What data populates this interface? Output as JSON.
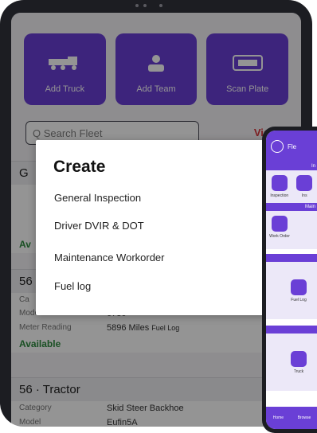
{
  "tablet": {
    "tiles": [
      {
        "label": "Add Truck",
        "icon": "truck-icon"
      },
      {
        "label": "Add Team",
        "icon": "person-icon"
      },
      {
        "label": "Scan Plate",
        "icon": "scan-icon"
      }
    ],
    "search": {
      "text": "Q  Search Fleet",
      "view_all": "View All"
    },
    "cards": [
      {
        "title": "G"
      },
      {
        "title": "56",
        "rows": [
          {
            "key": "Ca",
            "value": ""
          },
          {
            "key": "Model",
            "value": "6780"
          },
          {
            "key": "Meter Reading",
            "value": "5896 Miles"
          }
        ],
        "status": "Available"
      },
      {
        "title": "56 · Tractor",
        "rows": [
          {
            "key": "Category",
            "value": "Skid Steer Backhoe"
          },
          {
            "key": "Model",
            "value": "Eufin5A"
          }
        ]
      }
    ],
    "first_card_status": "Av",
    "fuel_log_behind": "Fuel Log"
  },
  "popup": {
    "title": "Create",
    "options": [
      "General Inspection",
      "Driver DVIR & DOT",
      "Maintenance Workorder",
      "Fuel log"
    ]
  },
  "phone": {
    "header": "Fle",
    "band1": "In",
    "sect1": [
      "Inspection",
      "Ins"
    ],
    "band2": "Main",
    "sect2": [
      "Work Order"
    ],
    "sect3": [
      "Fuel Log"
    ],
    "sect4": [
      "Truck"
    ],
    "nav": [
      "Home",
      "Browse"
    ]
  },
  "colors": {
    "brand": "#6a3fd6",
    "accent": "#d8343a",
    "success": "#2e8b3e"
  }
}
